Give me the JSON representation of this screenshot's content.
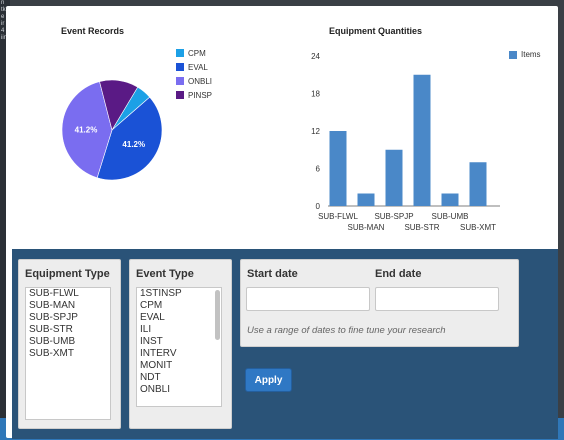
{
  "background_strip_text": [
    "n",
    "tk",
    "e",
    "ir",
    "4",
    "iin"
  ],
  "pie_chart": {
    "title": "Event Records",
    "legend": [
      {
        "label": "CPM",
        "color": "#1ca0e6"
      },
      {
        "label": "EVAL",
        "color": "#1a52d6"
      },
      {
        "label": "ONBLI",
        "color": "#7a6df0"
      },
      {
        "label": "PINSP",
        "color": "#5a1a85"
      }
    ]
  },
  "bar_chart": {
    "title": "Equipment Quantities",
    "legend_label": "Items"
  },
  "chart_data": [
    {
      "type": "pie",
      "title": "Event Records",
      "labels": [
        "CPM",
        "EVAL",
        "ONBLI",
        "PINSP"
      ],
      "values": [
        5.0,
        41.2,
        41.2,
        12.6
      ],
      "data_labels": [
        "41.2%",
        "41.2%"
      ],
      "colors": [
        "#1ca0e6",
        "#1a52d6",
        "#7a6df0",
        "#5a1a85"
      ],
      "legend_position": "right"
    },
    {
      "type": "bar",
      "title": "Equipment Quantities",
      "categories": [
        "SUB-FLWL",
        "SUB-MAN",
        "SUB-SPJP",
        "SUB-STR",
        "SUB-UMB",
        "SUB-XMT"
      ],
      "series": [
        {
          "name": "Items",
          "values": [
            12,
            2,
            9,
            21,
            2,
            7
          ]
        }
      ],
      "ylim": [
        0,
        24
      ],
      "yticks": [
        0,
        6,
        12,
        18,
        24
      ],
      "color": "#4a88c8",
      "legend_position": "right"
    }
  ],
  "filters": {
    "equipment_type": {
      "label": "Equipment Type",
      "options": [
        "SUB-FLWL",
        "SUB-MAN",
        "SUB-SPJP",
        "SUB-STR",
        "SUB-UMB",
        "SUB-XMT"
      ]
    },
    "event_type": {
      "label": "Event Type",
      "options": [
        "1STINSP",
        "CPM",
        "EVAL",
        "ILI",
        "INST",
        "INTERV",
        "MONIT",
        "NDT",
        "ONBLI"
      ]
    },
    "start_date": {
      "label": "Start date",
      "value": ""
    },
    "end_date": {
      "label": "End date",
      "value": ""
    },
    "hint": "Use a range of dates to fine tune your research",
    "apply_label": "Apply"
  }
}
